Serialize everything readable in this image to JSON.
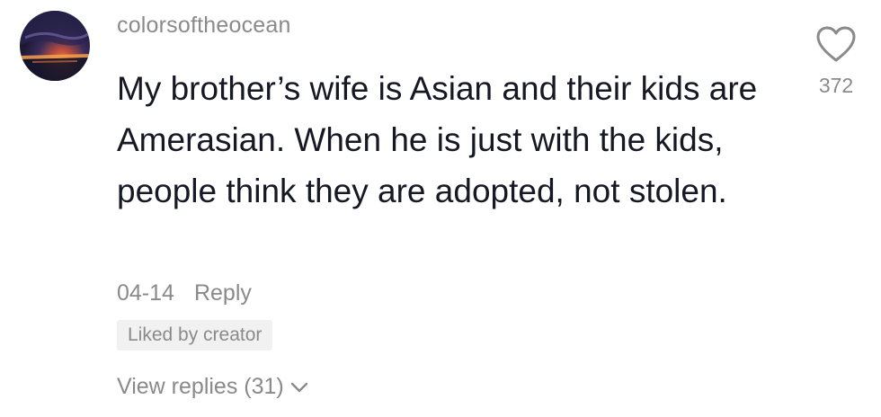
{
  "comment": {
    "username": "colorsoftheocean",
    "text": "My brother’s wife is Asian and their kids are Amerasian. When he is just with the kids, people think they are adopted, not stolen.",
    "date": "04-14",
    "reply_label": "Reply",
    "badge": "Liked by creator",
    "view_replies": "View replies (31)",
    "like_count": "372",
    "icons": {
      "like": "heart-outline-icon",
      "expand": "chevron-down-icon"
    },
    "colors": {
      "text": "#161823",
      "secondary": "#8a8a8a",
      "badge_bg": "#f1f1f2"
    }
  }
}
